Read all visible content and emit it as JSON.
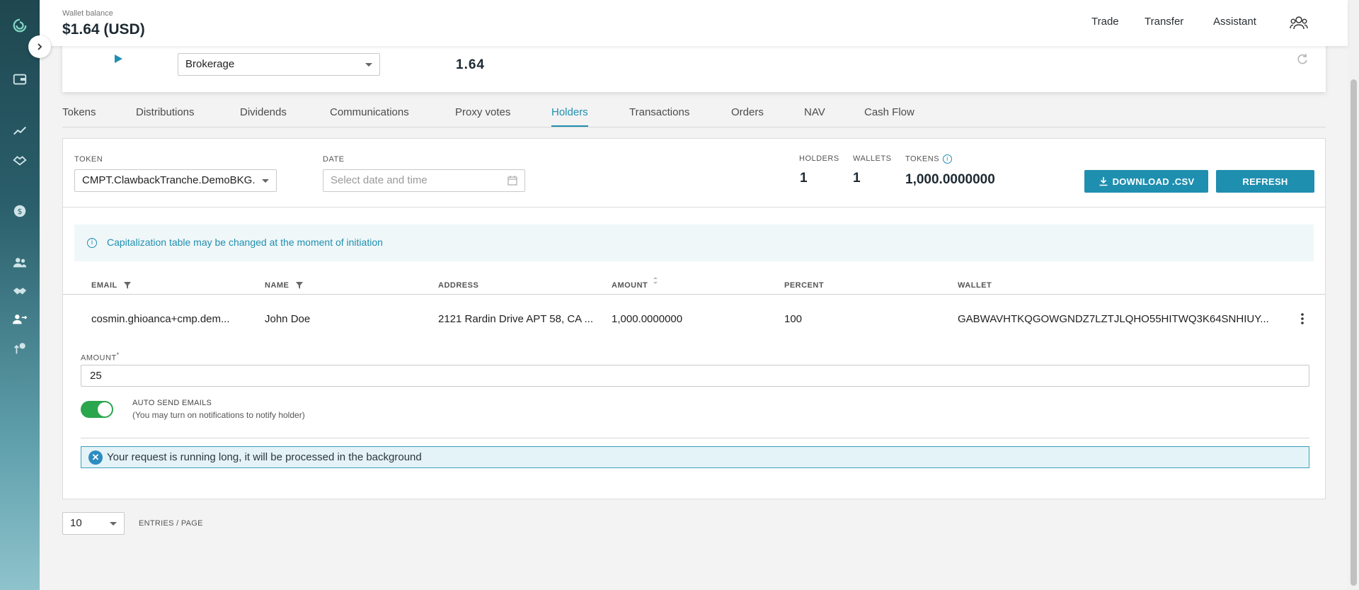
{
  "header": {
    "wallet_balance_label": "Wallet balance",
    "wallet_balance_value": "$1.64 (USD)",
    "nav": [
      "Trade",
      "Transfer",
      "Assistant"
    ]
  },
  "wallet_card": {
    "active_wallet_value": "Brokerage",
    "balance_value": "1.64"
  },
  "tabs": [
    "Tokens",
    "Distributions",
    "Dividends",
    "Communications",
    "Proxy votes",
    "Holders",
    "Transactions",
    "Orders",
    "NAV",
    "Cash Flow"
  ],
  "active_tab": "Holders",
  "filters": {
    "token_label": "TOKEN",
    "token_value": "CMPT.ClawbackTranche.DemoBKG.",
    "date_label": "DATE",
    "date_placeholder": "Select date and time"
  },
  "stats": {
    "holders_label": "HOLDERS",
    "holders_value": "1",
    "wallets_label": "WALLETS",
    "wallets_value": "1",
    "tokens_label": "TOKENS",
    "tokens_value": "1,000.0000000"
  },
  "buttons": {
    "download": "DOWNLOAD .CSV",
    "refresh": "REFRESH"
  },
  "info_banner": "Capitalization table may be changed at the moment of initiation",
  "table": {
    "columns": [
      "EMAIL",
      "NAME",
      "ADDRESS",
      "AMOUNT",
      "PERCENT",
      "WALLET"
    ],
    "rows": [
      {
        "email": "cosmin.ghioanca+cmp.dem...",
        "name": "John Doe",
        "address": "2121 Rardin Drive APT 58, CA ...",
        "amount": "1,000.0000000",
        "percent": "100",
        "wallet": "GABWAVHTKQGOWGNDZ7LZTJLQHO55HITWQ3K64SNHIUY..."
      }
    ]
  },
  "expanded_form": {
    "amount_label": "AMOUNT",
    "amount_required_mark": "*",
    "amount_value": "25",
    "auto_send_title": "AUTO SEND EMAILS",
    "auto_send_subtitle": "(You may turn on notifications to notify holder)",
    "auto_send_enabled": true,
    "alert_text": "Your request is running long, it will be processed in the background"
  },
  "pagination": {
    "entries_value": "10",
    "entries_label": "ENTRIES / PAGE"
  },
  "colors": {
    "accent": "#1f8fb0",
    "toggle_on": "#2aa64d",
    "sidebar_top": "#1f4750",
    "sidebar_bottom": "#8fc3cc"
  }
}
